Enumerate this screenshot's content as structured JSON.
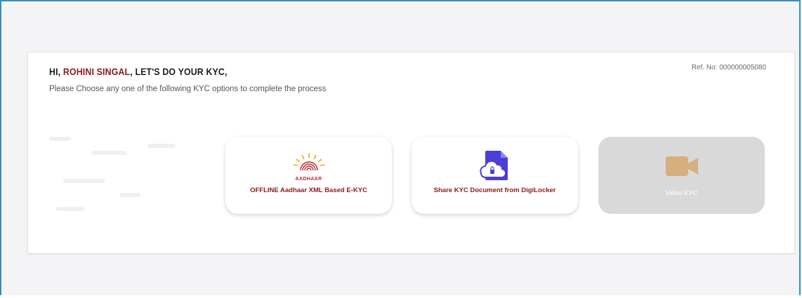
{
  "header": {
    "greeting_prefix": "HI,",
    "user_name": "ROHINI SINGAL",
    "greeting_suffix": ", LET'S DO YOUR KYC,",
    "subtext": "Please Choose any one of the following KYC options to complete the process",
    "ref_label": "Ref. No:",
    "ref_number": "000000005080"
  },
  "options": [
    {
      "icon": "aadhaar-logo-icon",
      "logo_text": "AADHAAR",
      "label": "OFFLINE Aadhaar XML Based E-KYC",
      "enabled": true
    },
    {
      "icon": "digilocker-icon",
      "label": "Share KYC Document from DigiLocker",
      "enabled": true
    },
    {
      "icon": "video-camera-icon",
      "label": "Video KYC",
      "enabled": false
    }
  ],
  "colors": {
    "frame_border": "#2f8fc3",
    "name_color": "#8b1a1a",
    "option_label": "#8b1a1a",
    "digilocker_purple": "#4b3fd6",
    "video_icon": "#d7ae7d",
    "disabled_bg": "#d9d9d9"
  }
}
